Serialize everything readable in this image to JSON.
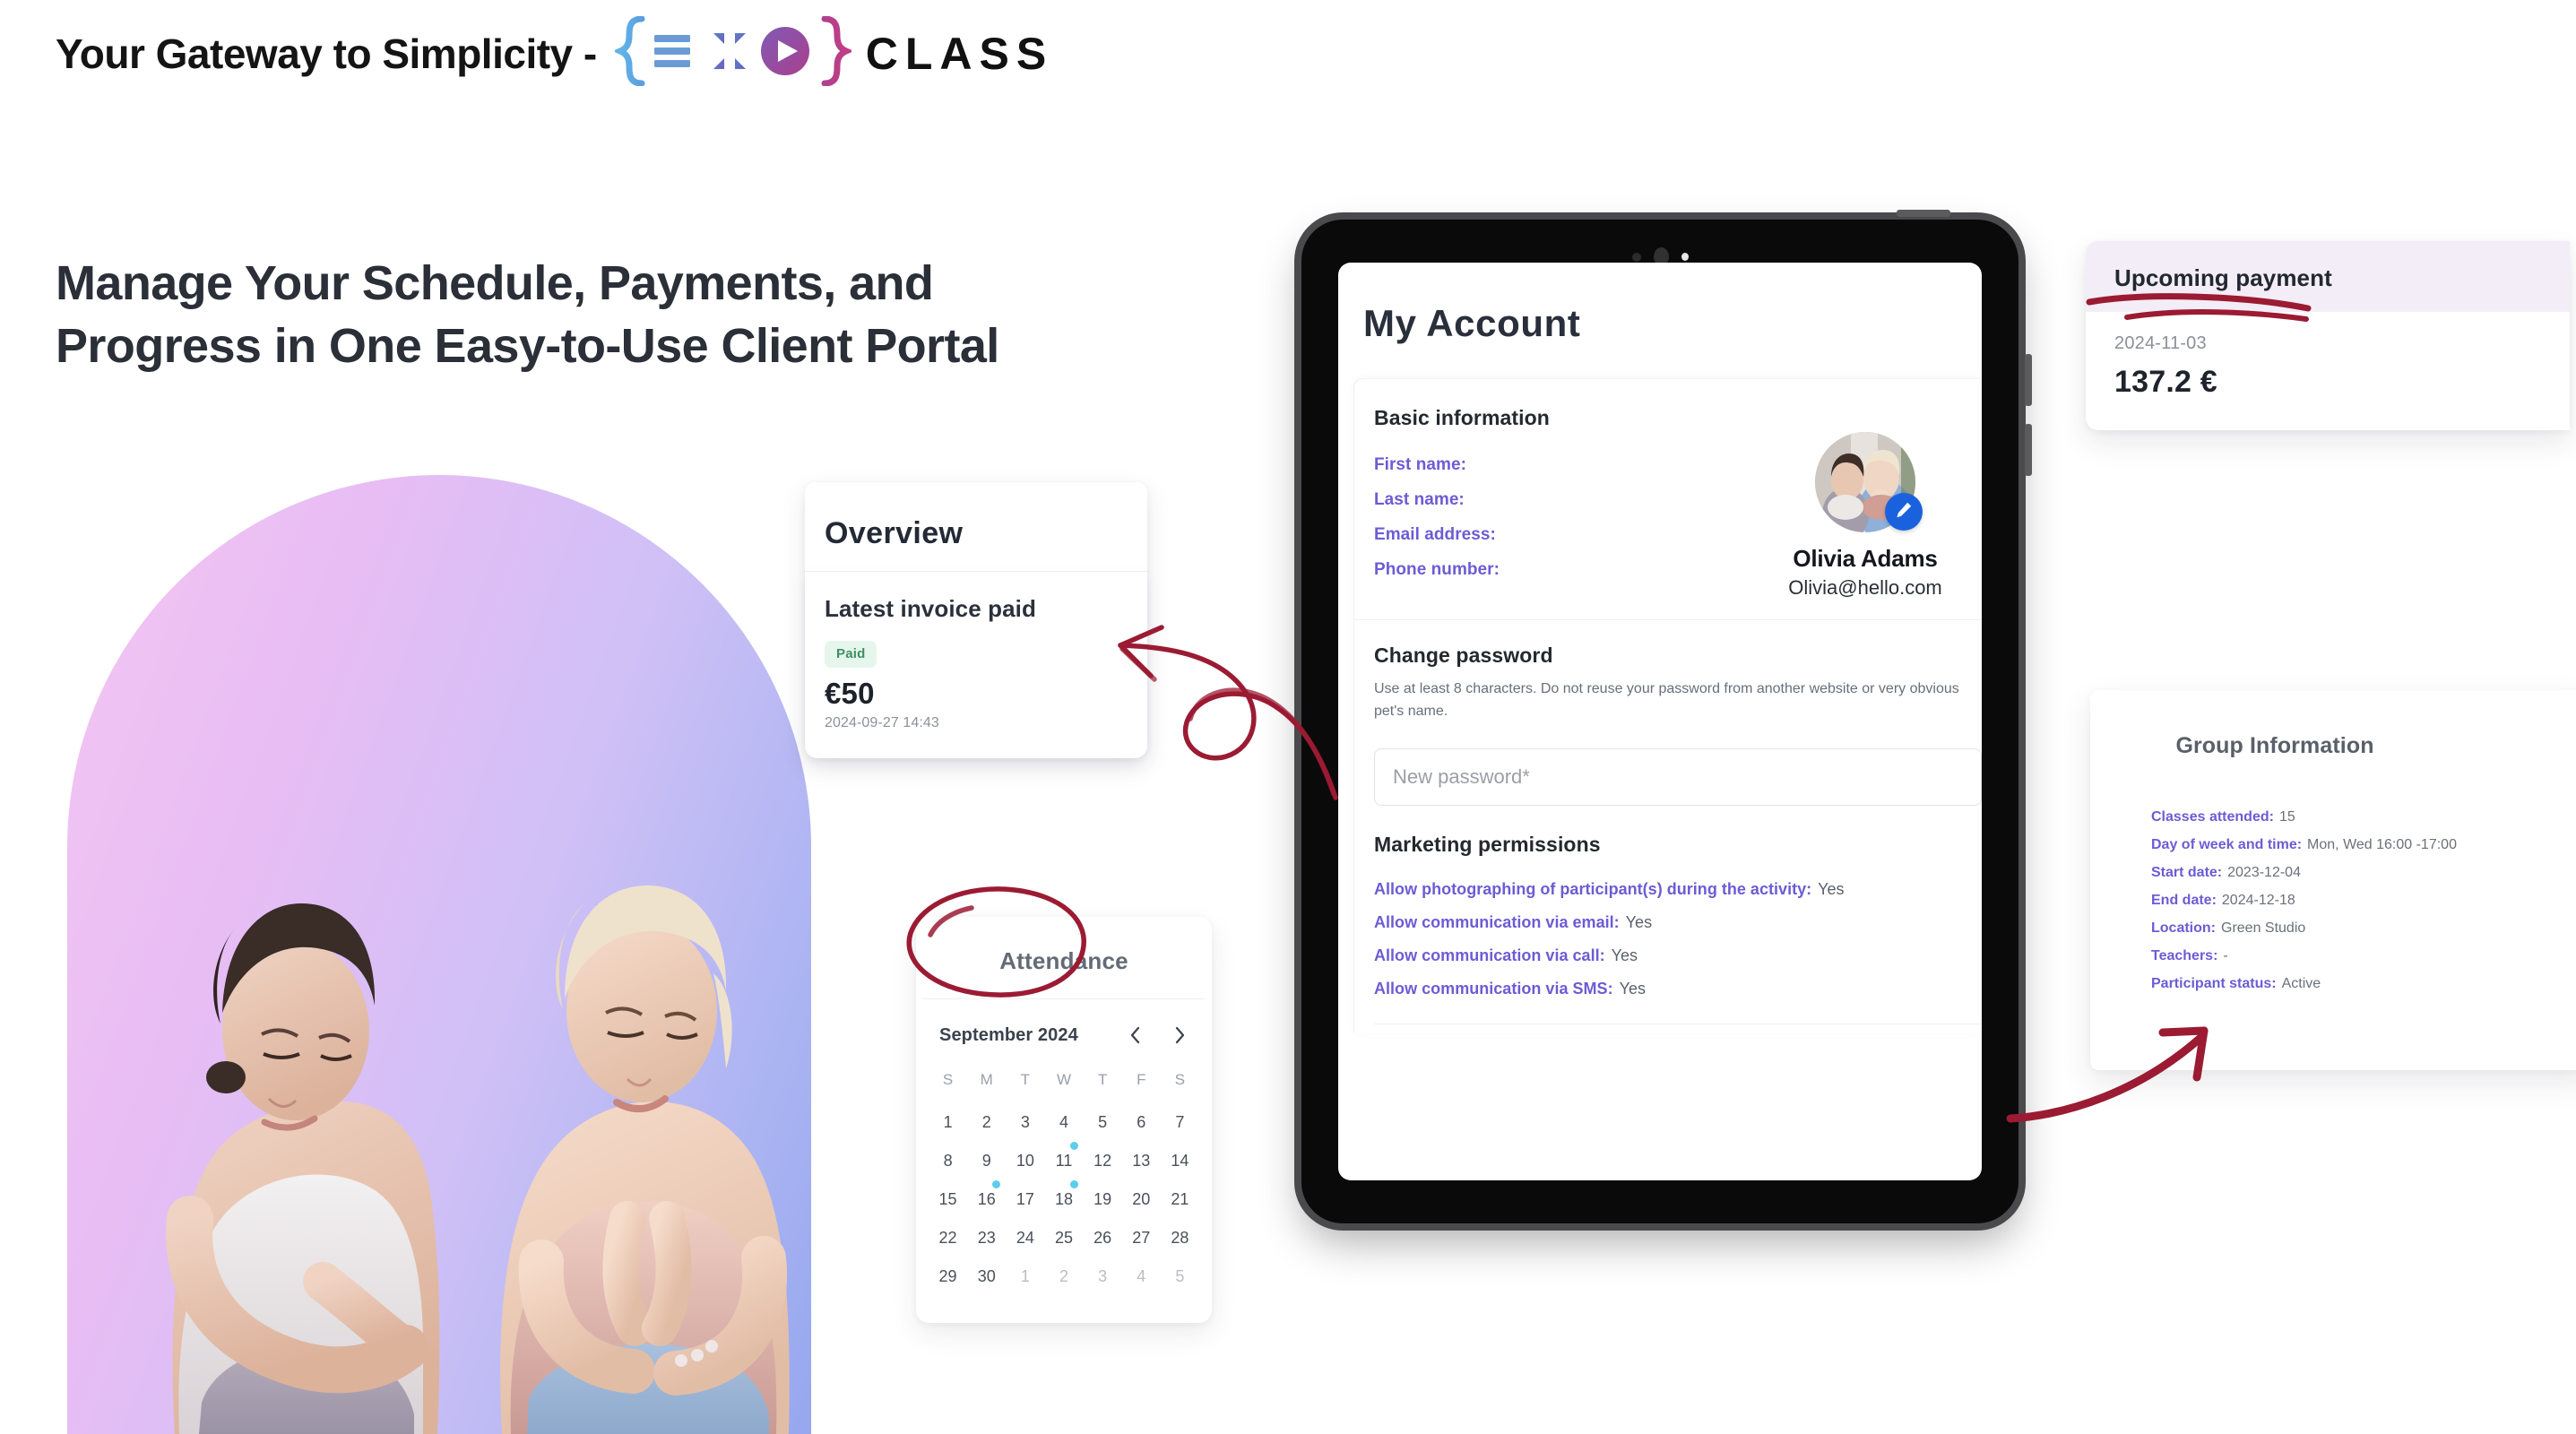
{
  "header": {
    "tagline": "Your Gateway to Simplicity -",
    "logo_word": "CLASS",
    "logo_icon": "exoclass-brackets-logo"
  },
  "headline": "Manage Your Schedule, Payments, and Progress in One Easy-to-Use Client Portal",
  "overview": {
    "title": "Overview",
    "invoice": {
      "title": "Latest invoice paid",
      "status_badge": "Paid",
      "amount": "€50",
      "date": "2024-09-27 14:43"
    }
  },
  "attendance": {
    "title": "Attendance",
    "calendar": {
      "month_label": "September 2024",
      "prev_icon": "chevron-left-icon",
      "next_icon": "chevron-right-icon",
      "dow": [
        "S",
        "M",
        "T",
        "W",
        "T",
        "F",
        "S"
      ],
      "weeks": [
        [
          {
            "d": "1"
          },
          {
            "d": "2"
          },
          {
            "d": "3"
          },
          {
            "d": "4"
          },
          {
            "d": "5"
          },
          {
            "d": "6"
          },
          {
            "d": "7"
          }
        ],
        [
          {
            "d": "8"
          },
          {
            "d": "9"
          },
          {
            "d": "10"
          },
          {
            "d": "11",
            "dot": true
          },
          {
            "d": "12"
          },
          {
            "d": "13"
          },
          {
            "d": "14"
          }
        ],
        [
          {
            "d": "15"
          },
          {
            "d": "16",
            "dot": true
          },
          {
            "d": "17"
          },
          {
            "d": "18",
            "dot": true
          },
          {
            "d": "19"
          },
          {
            "d": "20"
          },
          {
            "d": "21"
          }
        ],
        [
          {
            "d": "22"
          },
          {
            "d": "23"
          },
          {
            "d": "24"
          },
          {
            "d": "25"
          },
          {
            "d": "26"
          },
          {
            "d": "27"
          },
          {
            "d": "28"
          }
        ],
        [
          {
            "d": "29"
          },
          {
            "d": "30"
          },
          {
            "d": "1",
            "muted": true
          },
          {
            "d": "2",
            "muted": true
          },
          {
            "d": "3",
            "muted": true
          },
          {
            "d": "4",
            "muted": true
          },
          {
            "d": "5",
            "muted": true
          }
        ]
      ],
      "dot_color": "#5ccdec"
    }
  },
  "tablet": {
    "screen": {
      "page_title": "My Account",
      "basic": {
        "section_title": "Basic information",
        "labels": [
          "First name:",
          "Last name:",
          "Email address:",
          "Phone number:"
        ],
        "profile_name": "Olivia Adams",
        "profile_email": "Olivia@hello.com",
        "edit_icon": "pencil-edit-icon",
        "avatar_icon": "user-avatar-photo"
      },
      "password": {
        "section_title": "Change password",
        "description": "Use at least 8 characters. Do not reuse your password from another website or very obvious pet's name.",
        "input_placeholder": "New password*",
        "input_value": ""
      },
      "marketing": {
        "section_title": "Marketing permissions",
        "rows": [
          {
            "key": "Allow photographing of participant(s) during the activity:",
            "value": "Yes"
          },
          {
            "key": "Allow communication via email:",
            "value": "Yes"
          },
          {
            "key": "Allow communication via call:",
            "value": "Yes"
          },
          {
            "key": "Allow communication via SMS:",
            "value": "Yes"
          }
        ]
      }
    }
  },
  "upcoming_payment": {
    "title": "Upcoming payment",
    "date": "2024-11-03",
    "amount": "137.2 €"
  },
  "group_information": {
    "title": "Group Information",
    "rows": [
      {
        "key": "Classes attended:",
        "value": "15"
      },
      {
        "key": "Day of week and time:",
        "value": "Mon, Wed 16:00 -17:00"
      },
      {
        "key": "Start date:",
        "value": "2023-12-04"
      },
      {
        "key": "End date:",
        "value": "2024-12-18"
      },
      {
        "key": "Location:",
        "value": "Green Studio"
      },
      {
        "key": "Teachers:",
        "value": "-"
      },
      {
        "key": "Participant status:",
        "value": "Active"
      }
    ]
  },
  "annotations": {
    "color": "#9b1b33",
    "items": [
      {
        "name": "arrow-to-overview-card"
      },
      {
        "name": "circle-around-attendance"
      },
      {
        "name": "underline-upcoming-payment"
      },
      {
        "name": "arrow-to-group-information"
      }
    ]
  },
  "colors": {
    "accent_purple": "#6c5cd4",
    "brand_blue": "#1a62dd",
    "badge_green_text": "#3f8f63",
    "badge_green_bg": "#e6f6ec",
    "annotation_red": "#9b1b33",
    "calendar_dot": "#5ccdec"
  }
}
